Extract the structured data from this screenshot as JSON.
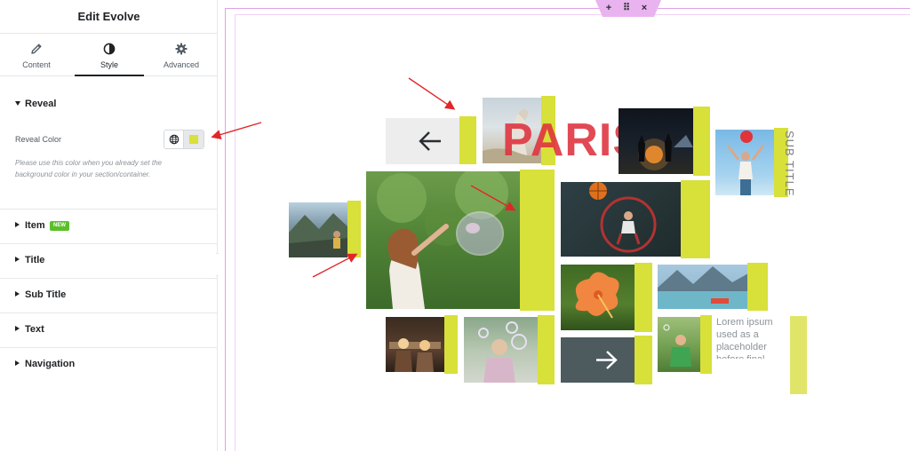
{
  "panel": {
    "title": "Edit Evolve",
    "tabs": [
      {
        "label": "Content",
        "icon": "pencil-icon"
      },
      {
        "label": "Style",
        "icon": "half-circle-icon"
      },
      {
        "label": "Advanced",
        "icon": "gear-icon"
      }
    ],
    "active_tab": "Style",
    "reveal": {
      "heading": "Reveal",
      "color_label": "Reveal Color",
      "color_value": "#d8e03a",
      "help_text": "Please use this color when you already set the background color in your section/container."
    },
    "sections": [
      {
        "label": "Item",
        "badge": "NEW"
      },
      {
        "label": "Title"
      },
      {
        "label": "Sub Title"
      },
      {
        "label": "Text"
      },
      {
        "label": "Navigation"
      }
    ]
  },
  "canvas": {
    "title": "PARIS",
    "sub_title": "SUB TITLE",
    "text": "Lorem ipsum used as a placeholder before final.",
    "accent_color": "#d8e03a",
    "outline_color": "#e1a0ea",
    "tools": {
      "add": "+",
      "move": "⠿",
      "close": "×"
    },
    "nav": {
      "prev": "arrow-left-icon",
      "next": "arrow-right-icon"
    }
  }
}
